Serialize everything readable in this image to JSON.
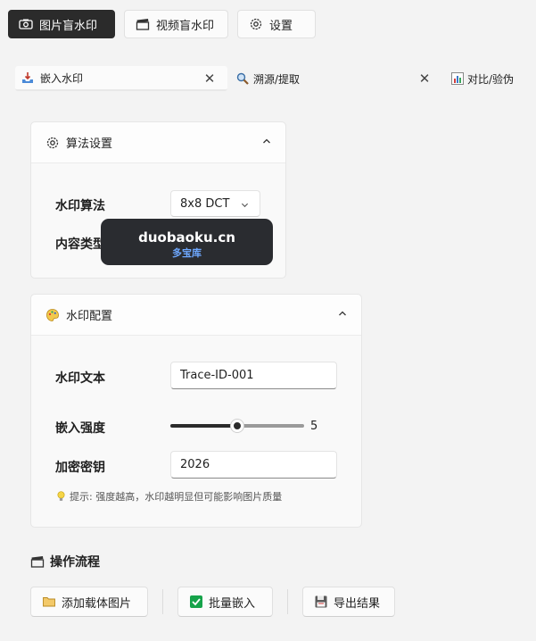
{
  "top_tabs": [
    {
      "label": "图片盲水印",
      "icon": "camera-icon",
      "active": true
    },
    {
      "label": "视频盲水印",
      "icon": "clapperboard-icon",
      "active": false
    },
    {
      "label": "设置",
      "icon": "gear-icon",
      "active": false
    }
  ],
  "sub_tabs": [
    {
      "label": "嵌入水印",
      "icon": "inbox-tray-icon",
      "active": true
    },
    {
      "label": "溯源/提取",
      "icon": "magnifier-icon",
      "active": false
    },
    {
      "label": "对比/验伪",
      "icon": "bar-chart-icon",
      "active": false
    }
  ],
  "algorithm_card": {
    "title": "算法设置",
    "algorithm_label": "水印算法",
    "algorithm_value": "8x8 DCT",
    "content_type_label": "内容类型"
  },
  "watermark_overlay": {
    "site": "duobaoku.cn",
    "name": "多宝库"
  },
  "watermark_card": {
    "title": "水印配置",
    "text_label": "水印文本",
    "text_value": "Trace-ID-001",
    "strength_label": "嵌入强度",
    "strength_value": "5",
    "strength_fraction": 0.5,
    "key_label": "加密密钥",
    "key_value": "2026",
    "hint": "提示: 强度越高，水印越明显但可能影响图片质量"
  },
  "workflow": {
    "title": "操作流程",
    "buttons": [
      {
        "label": "添加载体图片",
        "icon": "folder-icon"
      },
      {
        "label": "批量嵌入",
        "icon": "check-box-icon"
      },
      {
        "label": "导出结果",
        "icon": "floppy-disk-icon"
      }
    ]
  },
  "colors": {
    "active_tab": "#2b2b2b",
    "background": "#f3f3f3",
    "check_green": "#16a34a"
  }
}
